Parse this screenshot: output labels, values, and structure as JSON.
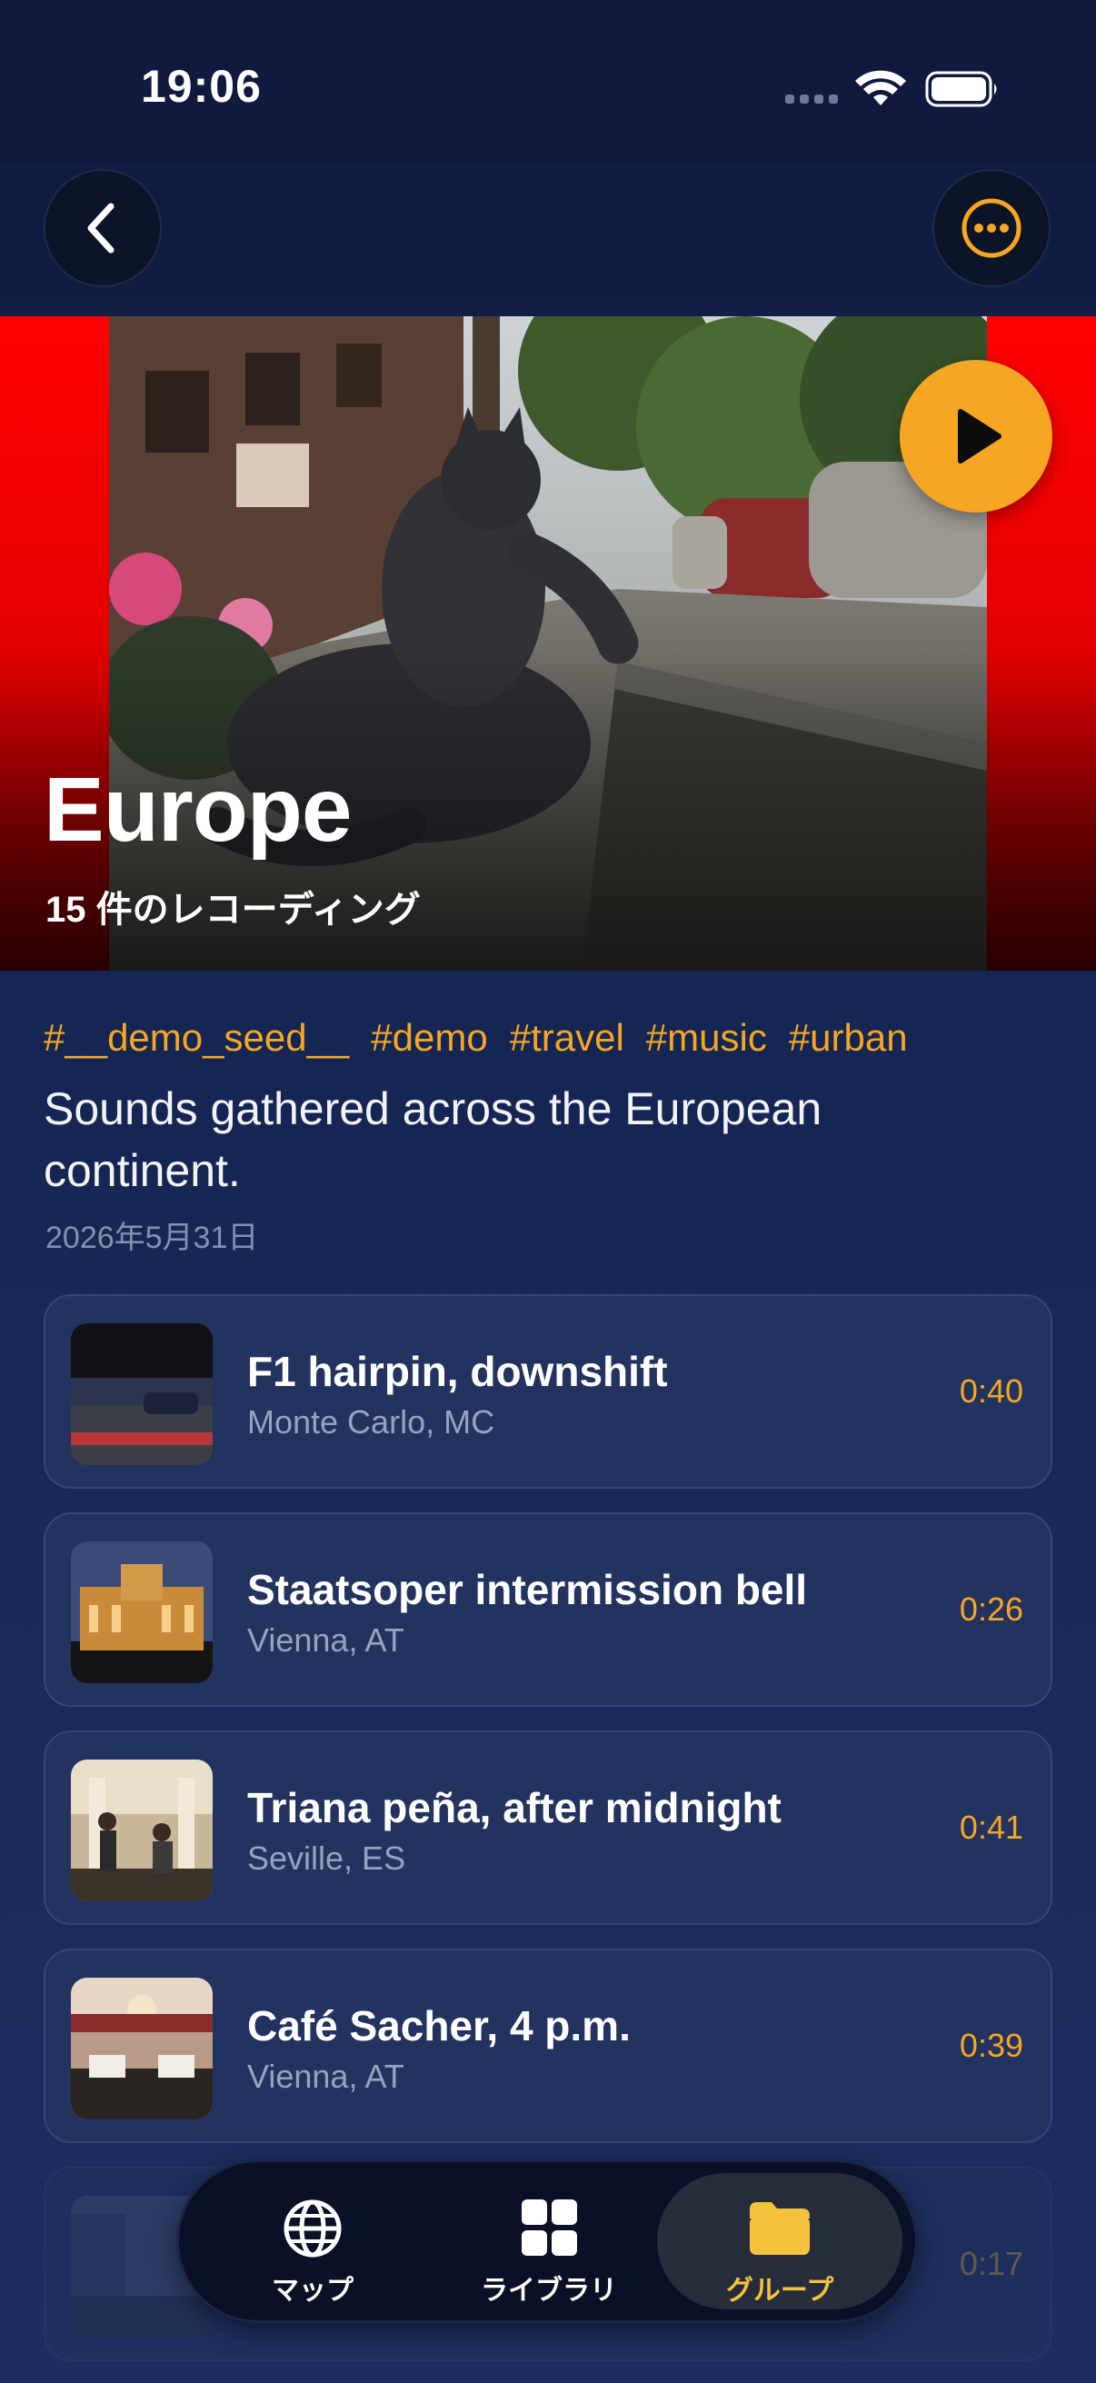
{
  "status_bar": {
    "time": "19:06"
  },
  "group": {
    "title": "Europe",
    "subtitle": "15 件のレコーディング",
    "tags": [
      "#__demo_seed__",
      "#demo",
      "#travel",
      "#music",
      "#urban"
    ],
    "description": "Sounds gathered across the European continent.",
    "date": "2026年5月31日"
  },
  "recordings": [
    {
      "title": "F1 hairpin, downshift",
      "location": "Monte Carlo, MC",
      "duration": "0:40"
    },
    {
      "title": "Staatsoper intermission bell",
      "location": "Vienna, AT",
      "duration": "0:26"
    },
    {
      "title": "Triana peña, after midnight",
      "location": "Seville, ES",
      "duration": "0:41"
    },
    {
      "title": "Café Sacher, 4 p.m.",
      "location": "Vienna, AT",
      "duration": "0:39"
    },
    {
      "title": "",
      "location": "",
      "duration": "0:17"
    }
  ],
  "tab_bar": {
    "tabs": [
      {
        "label": "マップ",
        "icon": "globe-icon"
      },
      {
        "label": "ライブラリ",
        "icon": "grid-icon"
      },
      {
        "label": "グループ",
        "icon": "folder-icon",
        "selected": true
      }
    ]
  },
  "colors": {
    "accent": "#f5a623",
    "background": "#14234a",
    "card": "#233360",
    "hero": "#ff0000"
  }
}
